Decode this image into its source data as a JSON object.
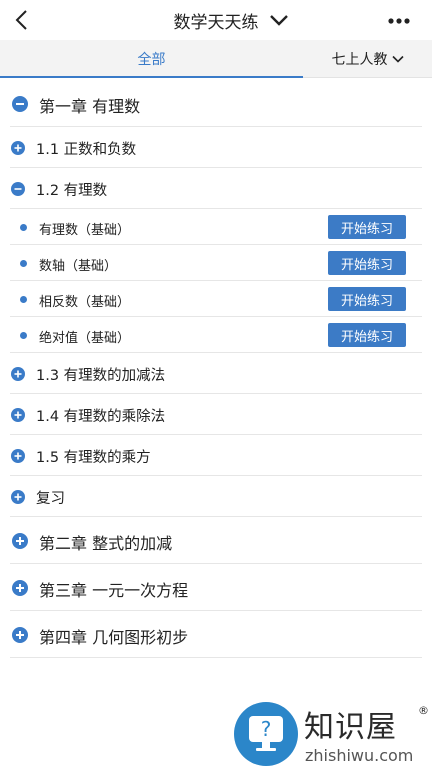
{
  "header": {
    "title": "数学天天练",
    "back_icon": "chevron-left-icon",
    "more_icon": "more-horizontal-icon"
  },
  "tabs": {
    "all_label": "全部",
    "grade_label": "七上人教"
  },
  "accent_color": "#3a7bc8",
  "list": {
    "chapter1": "第一章 有理数",
    "sec_1_1": "1.1 正数和负数",
    "sec_1_2": "1.2 有理数",
    "lessons": [
      {
        "label": "有理数（基础）",
        "button": "开始练习"
      },
      {
        "label": "数轴（基础）",
        "button": "开始练习"
      },
      {
        "label": "相反数（基础）",
        "button": "开始练习"
      },
      {
        "label": "绝对值（基础）",
        "button": "开始练习"
      }
    ],
    "sec_1_3": "1.3 有理数的加减法",
    "sec_1_4": "1.4 有理数的乘除法",
    "sec_1_5": "1.5 有理数的乘方",
    "review": "复习",
    "chapter2": "第二章 整式的加减",
    "chapter3": "第三章 一元一次方程",
    "chapter4": "第四章 几何图形初步"
  },
  "watermark": {
    "brand": "知识屋",
    "reg": "®",
    "site": "zhishiwu.com"
  }
}
